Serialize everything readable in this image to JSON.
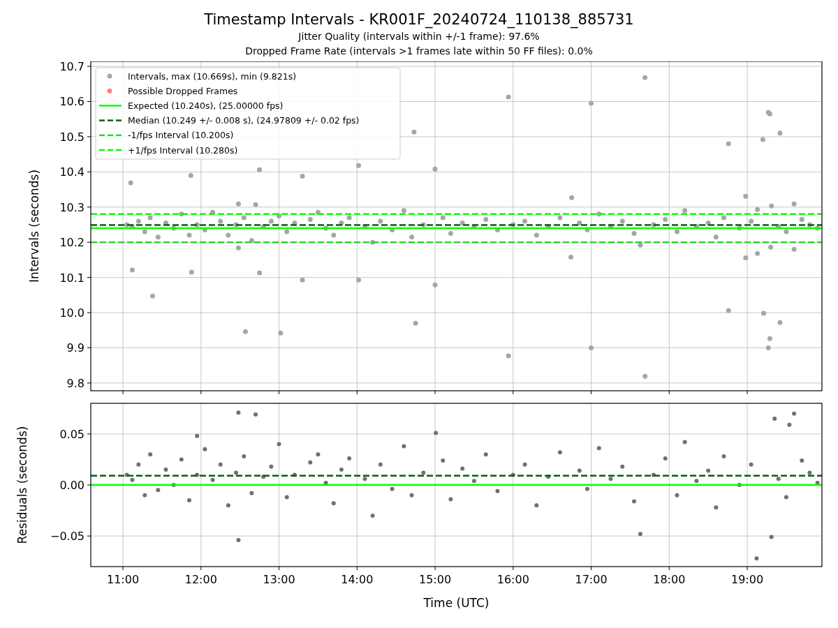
{
  "figure": {
    "title": "Timestamp Intervals - KR001F_20240724_110138_885731",
    "subtitles": [
      "Jitter Quality (intervals within +/-1 frame): 97.6%",
      "Dropped Frame Rate (intervals >1 frames late within 50 FF files): 0.0%"
    ]
  },
  "intervals_plot": {
    "legend": [
      {
        "label": "Possible Dropped Frames",
        "kind": "marker",
        "color": "#ff7f7f"
      },
      {
        "label": "Expected (10.240s), (25.00000 fps)",
        "kind": "solid",
        "color": "#00ff00"
      },
      {
        "label": "Median (10.249 +/- 0.008 s), (24.97809 +/- 0.02 fps)",
        "kind": "dashed",
        "color": "#006400"
      },
      {
        "label": "-1/fps Interval (10.200s)",
        "kind": "dashed",
        "color": "#22dd22"
      },
      {
        "label": "+1/fps Interval (10.280s)",
        "kind": "dashed",
        "color": "#00ff00"
      }
    ],
    "chart_data": {
      "type": "scatter",
      "ylabel": "Intervals (seconds)",
      "xlim": [
        10.588,
        19.957
      ],
      "ylim": [
        9.778,
        10.714
      ],
      "grid": true,
      "yticks": [
        {
          "value": 9.8,
          "label": "9.8"
        },
        {
          "value": 9.9,
          "label": "9.9"
        },
        {
          "value": 10,
          "label": "10.0"
        },
        {
          "value": 10.1,
          "label": "10.1"
        },
        {
          "value": 10.2,
          "label": "10.2"
        },
        {
          "value": 10.3,
          "label": "10.3"
        },
        {
          "value": 10.4,
          "label": "10.4"
        },
        {
          "value": 10.5,
          "label": "10.5"
        },
        {
          "value": 10.6,
          "label": "10.6"
        },
        {
          "value": 10.7,
          "label": "10.7"
        }
      ],
      "x": [
        11.05,
        11.12,
        11.2,
        11.28,
        11.35,
        11.45,
        11.55,
        11.65,
        11.75,
        11.85,
        11.95,
        12.05,
        12.15,
        12.25,
        12.35,
        12.45,
        12.55,
        12.65,
        12.8,
        12.9,
        13.0,
        13.1,
        13.2,
        13.4,
        13.5,
        13.6,
        13.7,
        13.8,
        13.9,
        14.1,
        14.2,
        14.3,
        14.45,
        14.6,
        14.7,
        14.85,
        15.1,
        15.2,
        15.35,
        15.5,
        15.65,
        15.8,
        16.0,
        16.15,
        16.3,
        16.45,
        16.6,
        16.85,
        16.95,
        17.1,
        17.25,
        17.4,
        17.55,
        17.8,
        17.95,
        18.1,
        18.2,
        18.35,
        18.5,
        18.6,
        18.7,
        18.9,
        19.05,
        19.4,
        19.5,
        19.7,
        19.8,
        19.9,
        11.1,
        11.12,
        11.38,
        11.87,
        11.88,
        12.48,
        12.48,
        12.57,
        12.7,
        12.75,
        12.75,
        13.02,
        13.3,
        13.3,
        14.02,
        14.02,
        14.73,
        14.75,
        15.0,
        15.0,
        15.94,
        15.94,
        16.75,
        16.74,
        17.0,
        17.0,
        17.69,
        17.69,
        17.63,
        18.76,
        18.76,
        18.98,
        18.98,
        19.2,
        19.21,
        19.27,
        19.29,
        19.27,
        19.29,
        19.31,
        19.3,
        19.42,
        19.42,
        19.6,
        19.6,
        19.13,
        19.13
      ],
      "series": [
        {
          "name": "Intervals, max (10.669s), min (9.821s)",
          "color": "#a6a6a6",
          "values": [
            10.25,
            10.245,
            10.26,
            10.23,
            10.27,
            10.215,
            10.255,
            10.24,
            10.28,
            10.22,
            10.25,
            10.235,
            10.285,
            10.26,
            10.22,
            10.25,
            10.27,
            10.205,
            10.245,
            10.26,
            10.275,
            10.23,
            10.255,
            10.265,
            10.285,
            10.24,
            10.22,
            10.255,
            10.27,
            10.245,
            10.2,
            10.26,
            10.235,
            10.29,
            10.215,
            10.25,
            10.27,
            10.225,
            10.255,
            10.245,
            10.265,
            10.235,
            10.25,
            10.26,
            10.22,
            10.245,
            10.27,
            10.255,
            10.235,
            10.28,
            10.245,
            10.26,
            10.225,
            10.25,
            10.265,
            10.23,
            10.29,
            10.245,
            10.255,
            10.215,
            10.27,
            10.24,
            10.26,
            10.245,
            10.23,
            10.265,
            10.25,
            10.24,
            10.369,
            10.121,
            10.047,
            10.39,
            10.115,
            10.309,
            10.184,
            9.946,
            10.307,
            10.406,
            10.113,
            9.942,
            10.388,
            10.093,
            10.418,
            10.093,
            10.513,
            9.97,
            10.408,
            10.079,
            10.613,
            9.877,
            10.327,
            10.158,
            10.595,
            9.9,
            10.668,
            9.819,
            10.192,
            10.48,
            10.006,
            10.331,
            10.156,
            10.492,
            9.998,
            10.569,
            10.565,
            9.9,
            9.926,
            10.303,
            10.186,
            10.51,
            9.972,
            10.309,
            10.18,
            10.168,
            10.293
          ]
        }
      ],
      "ref_lines": [
        {
          "axis": "y",
          "value": 10.24,
          "color": "#00ff00"
        },
        {
          "axis": "y",
          "value": 10.249,
          "color": "#006400"
        },
        {
          "axis": "y",
          "value": 10.2,
          "color": "#22dd22"
        },
        {
          "axis": "y",
          "value": 10.28,
          "color": "#00ff00"
        }
      ]
    }
  },
  "residuals_plot": {
    "chart_data": {
      "type": "scatter",
      "xlabel": "Time (UTC)",
      "ylabel": "Residuals (seconds)",
      "xlim": [
        10.588,
        19.957
      ],
      "ylim": [
        -0.08,
        0.08
      ],
      "grid": true,
      "xticks": [
        {
          "value": 11,
          "label": "11:00"
        },
        {
          "value": 12,
          "label": "12:00"
        },
        {
          "value": 13,
          "label": "13:00"
        },
        {
          "value": 14,
          "label": "14:00"
        },
        {
          "value": 15,
          "label": "15:00"
        },
        {
          "value": 16,
          "label": "16:00"
        },
        {
          "value": 17,
          "label": "17:00"
        },
        {
          "value": 18,
          "label": "18:00"
        },
        {
          "value": 19,
          "label": "19:00"
        }
      ],
      "yticks": [
        {
          "value": -0.05,
          "label": "−0.05"
        },
        {
          "value": 0,
          "label": "0.00"
        },
        {
          "value": 0.05,
          "label": "0.05"
        }
      ],
      "x": [
        11.05,
        11.12,
        11.2,
        11.28,
        11.35,
        11.45,
        11.55,
        11.65,
        11.75,
        11.85,
        11.95,
        12.05,
        12.15,
        12.25,
        12.35,
        12.45,
        12.55,
        12.65,
        12.8,
        12.9,
        13.0,
        13.1,
        13.2,
        13.4,
        13.5,
        13.6,
        13.7,
        13.8,
        13.9,
        14.1,
        14.2,
        14.3,
        14.45,
        14.6,
        14.7,
        14.85,
        15.1,
        15.2,
        15.35,
        15.5,
        15.65,
        15.8,
        16.0,
        16.15,
        16.3,
        16.45,
        16.6,
        16.85,
        16.95,
        17.1,
        17.25,
        17.4,
        17.55,
        17.8,
        17.95,
        18.1,
        18.2,
        18.35,
        18.5,
        18.6,
        18.7,
        18.9,
        19.05,
        19.4,
        19.5,
        19.7,
        19.8,
        19.9,
        12.48,
        12.7,
        12.48,
        19.54,
        19.12,
        19.31,
        19.6,
        17.63,
        15.01,
        11.95,
        19.35
      ],
      "series": [
        {
          "color": "#707070",
          "values": [
            0.01,
            0.005,
            0.02,
            -0.01,
            0.03,
            -0.005,
            0.015,
            0.0,
            0.025,
            -0.015,
            0.01,
            0.035,
            0.005,
            0.02,
            -0.02,
            0.012,
            0.028,
            -0.008,
            0.008,
            0.018,
            0.04,
            -0.012,
            0.01,
            0.022,
            0.03,
            0.002,
            -0.018,
            0.015,
            0.026,
            0.006,
            -0.03,
            0.02,
            -0.004,
            0.038,
            -0.01,
            0.012,
            0.024,
            -0.014,
            0.016,
            0.004,
            0.03,
            -0.006,
            0.01,
            0.02,
            -0.02,
            0.008,
            0.032,
            0.014,
            -0.004,
            0.036,
            0.006,
            0.018,
            -0.016,
            0.01,
            0.026,
            -0.01,
            0.042,
            0.004,
            0.014,
            -0.022,
            0.028,
            0.0,
            0.02,
            0.006,
            -0.012,
            0.024,
            0.012,
            0.002,
            0.071,
            0.069,
            -0.054,
            0.059,
            -0.072,
            -0.051,
            0.07,
            -0.048,
            0.051,
            0.048,
            0.065
          ]
        }
      ],
      "ref_lines": [
        {
          "axis": "y",
          "value": 0,
          "color": "#00ff00"
        },
        {
          "axis": "y",
          "value": 0.009,
          "color": "#006400"
        }
      ]
    }
  }
}
